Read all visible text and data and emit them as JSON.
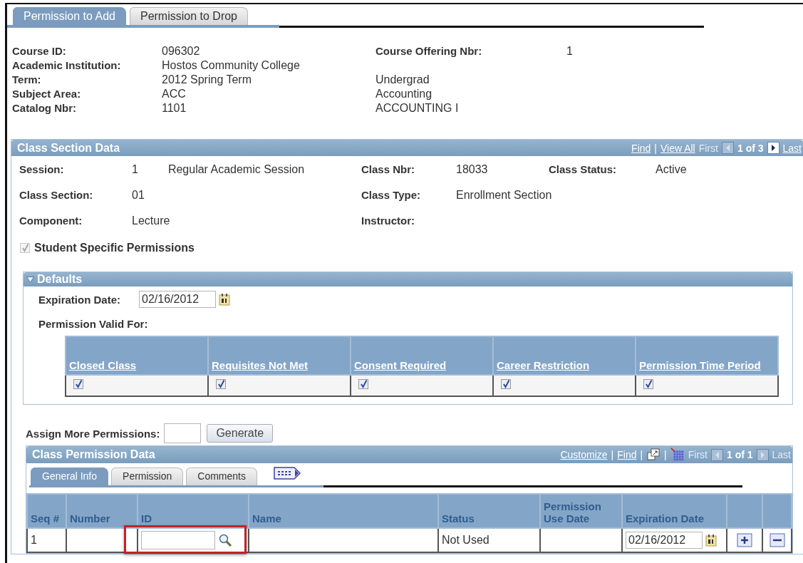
{
  "tabs": [
    {
      "label": "Permission to Add",
      "selected": true
    },
    {
      "label": "Permission to Drop",
      "selected": false
    }
  ],
  "course": [
    {
      "label": "Course ID:",
      "value": "096302",
      "right_label": "Course Offering Nbr:",
      "right_value": "1"
    },
    {
      "label": "Academic Institution:",
      "value": "Hostos Community College"
    },
    {
      "label": "Term:",
      "value": "2012 Spring Term",
      "right_text": "Undergrad"
    },
    {
      "label": "Subject Area:",
      "value": "ACC",
      "right_text": "Accounting"
    },
    {
      "label": "Catalog Nbr:",
      "value": "1101",
      "right_text": "ACCOUNTING I"
    }
  ],
  "class_section": {
    "title": "Class Section Data",
    "nav": {
      "links": [
        "Find",
        "View All"
      ],
      "separator": "|",
      "first": "First",
      "first_disabled": true,
      "prev_disabled": true,
      "count": "1 of 3",
      "next_disabled": false,
      "last": "Last",
      "last_disabled": false
    },
    "rows": [
      [
        {
          "label": "Session:",
          "values": [
            "1",
            "Regular Academic Session"
          ]
        },
        {
          "label": "Class Nbr:",
          "values": [
            "18033"
          ]
        },
        {
          "label": "Class Status:",
          "values": [
            "Active"
          ]
        }
      ],
      [
        {
          "label": "Class Section:",
          "values": [
            "01"
          ]
        },
        {
          "label": "Class Type:",
          "values": [
            "Enrollment Section"
          ]
        }
      ],
      [
        {
          "label": "Component:",
          "values": [
            "Lecture"
          ]
        },
        {
          "label": "Instructor:"
        }
      ]
    ],
    "student_specific": {
      "label": "Student Specific Permissions",
      "checked": true,
      "disabled": true
    },
    "defaults": {
      "title": "Defaults",
      "expanded": true,
      "expiration_label": "Expiration Date:",
      "expiration_value": "02/16/2012",
      "valid_for_label": "Permission Valid For:",
      "valid_for": [
        {
          "label": "Closed Class",
          "checked": true
        },
        {
          "label": "Requisites Not Met",
          "checked": true
        },
        {
          "label": "Consent Required",
          "checked": true
        },
        {
          "label": "Career Restriction",
          "checked": true
        },
        {
          "label": "Permission Time Period",
          "checked": true
        }
      ]
    },
    "assign_label": "Assign More Permissions:",
    "generate_button": "Generate",
    "permission_data": {
      "title": "Class Permission Data",
      "nav": {
        "links": [
          "Customize",
          "Find"
        ],
        "separator": "|",
        "first": "First",
        "first_disabled": true,
        "prev_disabled": true,
        "count": "1 of 1",
        "next_disabled": true,
        "last": "Last",
        "last_disabled": true
      },
      "tabs": [
        {
          "label": "General Info",
          "selected": true
        },
        {
          "label": "Permission",
          "selected": false
        },
        {
          "label": "Comments",
          "selected": false
        }
      ],
      "columns": [
        "Seq #",
        "Number",
        "ID",
        "Name",
        "Status",
        "Permission Use Date",
        "Expiration Date"
      ],
      "rows": [
        {
          "seq": "1",
          "id_highlighted": true,
          "status": "Not Used",
          "expiration_date": "02/16/2012"
        }
      ]
    }
  }
}
